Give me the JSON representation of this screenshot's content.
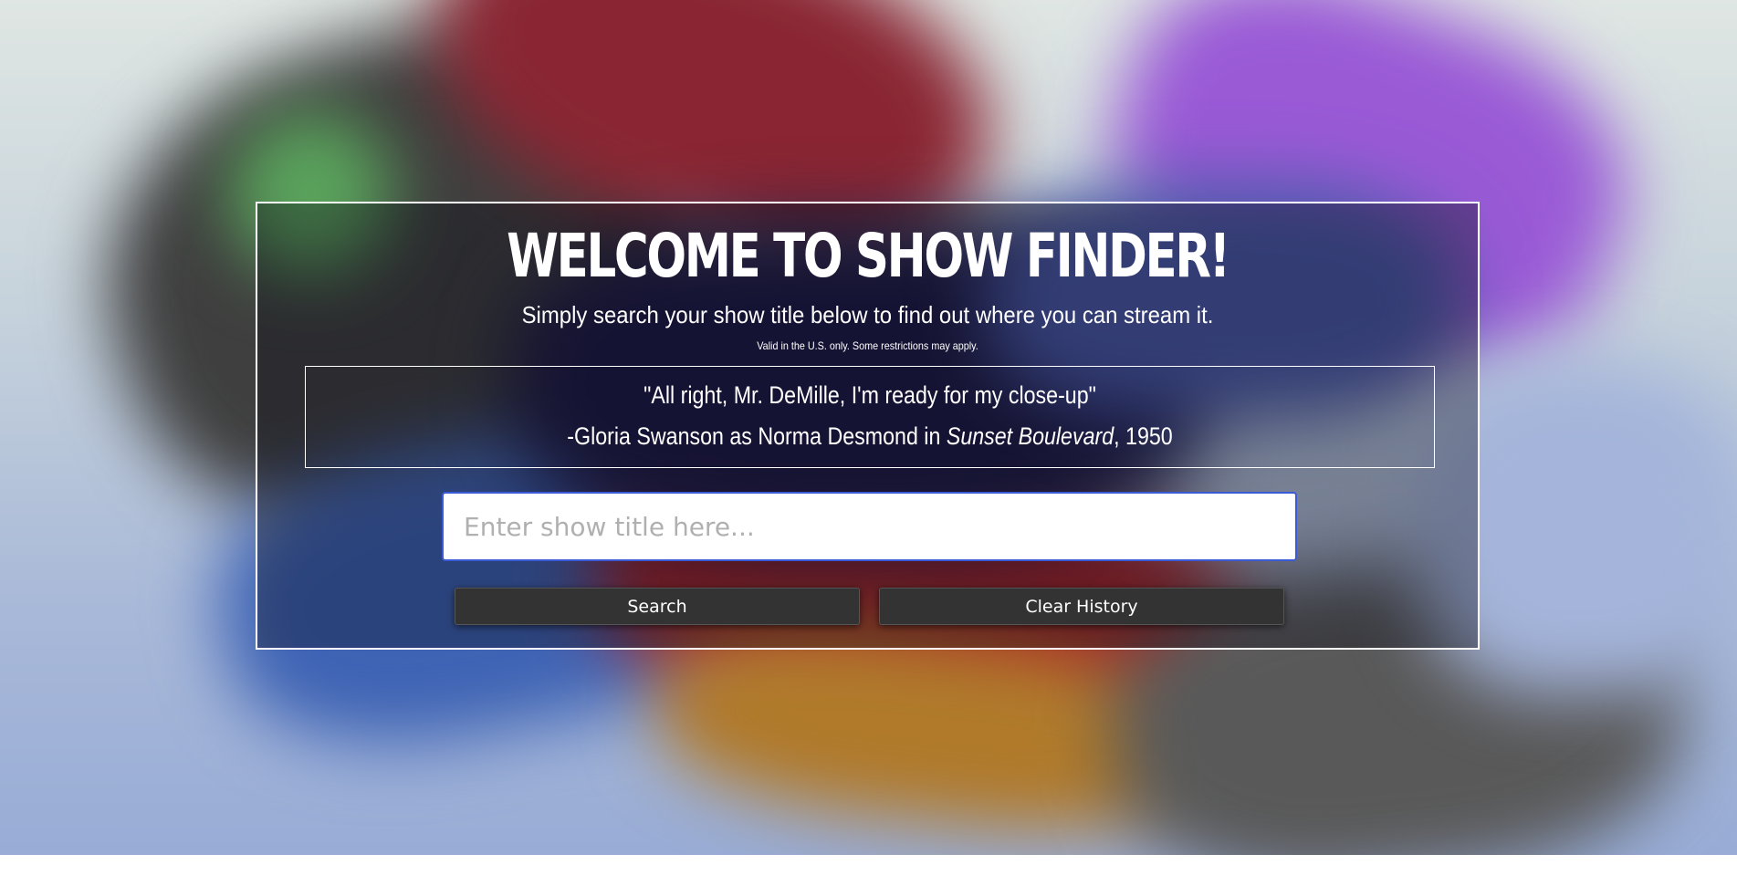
{
  "header": {
    "title": "WELCOME TO SHOW FINDER!",
    "subtitle": "Simply search your show title below to find out where you can stream it.",
    "disclaimer": "Valid in the U.S. only. Some restrictions may apply."
  },
  "quote": {
    "text": "\"All right, Mr. DeMille, I'm ready for my close-up\"",
    "attribution_prefix": "-Gloria Swanson as Norma Desmond in ",
    "film": "Sunset Boulevard",
    "attribution_suffix": ", 1950"
  },
  "search": {
    "placeholder": "Enter show title here...",
    "value": ""
  },
  "buttons": {
    "search_label": "Search",
    "clear_label": "Clear History"
  },
  "colors": {
    "input_border": "#3b5bd6",
    "button_bg": "#333333",
    "panel_border": "#ffffff"
  }
}
